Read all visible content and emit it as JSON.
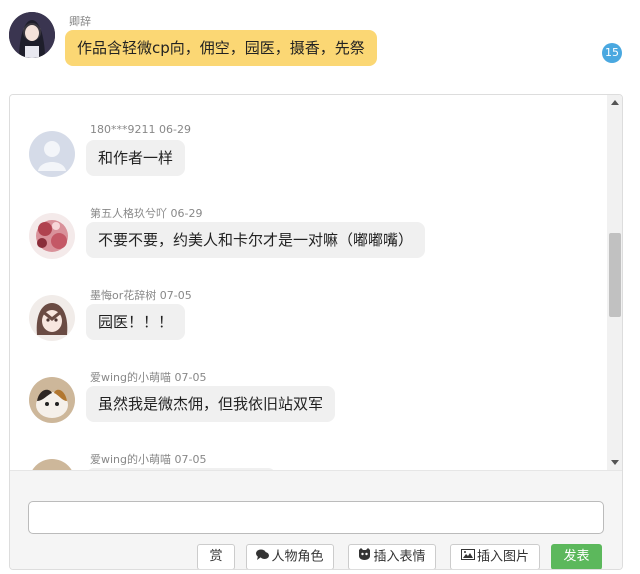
{
  "top_post": {
    "author": "卿辞",
    "message": "作品含轻微cp向，佣空，园医，摄香，先祭",
    "comment_count": "15"
  },
  "comments": [
    {
      "meta": "180***9211 06-29",
      "text": "和作者一样"
    },
    {
      "meta": "第五人格玖兮吖 06-29",
      "text": "不要不要，约美人和卡尔才是一对嘛（嘟嘟嘴）"
    },
    {
      "meta": "墨悔or花辞树 07-05",
      "text": "园医！！！"
    },
    {
      "meta": "爱wing的小萌喵 07-05",
      "text": "虽然我是微杰佣，但我依旧站双军"
    },
    {
      "meta": "爱wing的小萌喵 07-05",
      "text": ""
    }
  ],
  "composer": {
    "input_value": "",
    "reward_label": "赏",
    "character_label": "人物角色",
    "emoji_label": "插入表情",
    "image_label": "插入图片",
    "send_label": "发表"
  },
  "colors": {
    "top_bubble": "#fbd774",
    "comment_bubble": "#f0f0f0",
    "badge": "#4aa8e0",
    "send": "#5cb85c"
  },
  "scroll": {
    "thumb_position_fraction": 0.47
  }
}
